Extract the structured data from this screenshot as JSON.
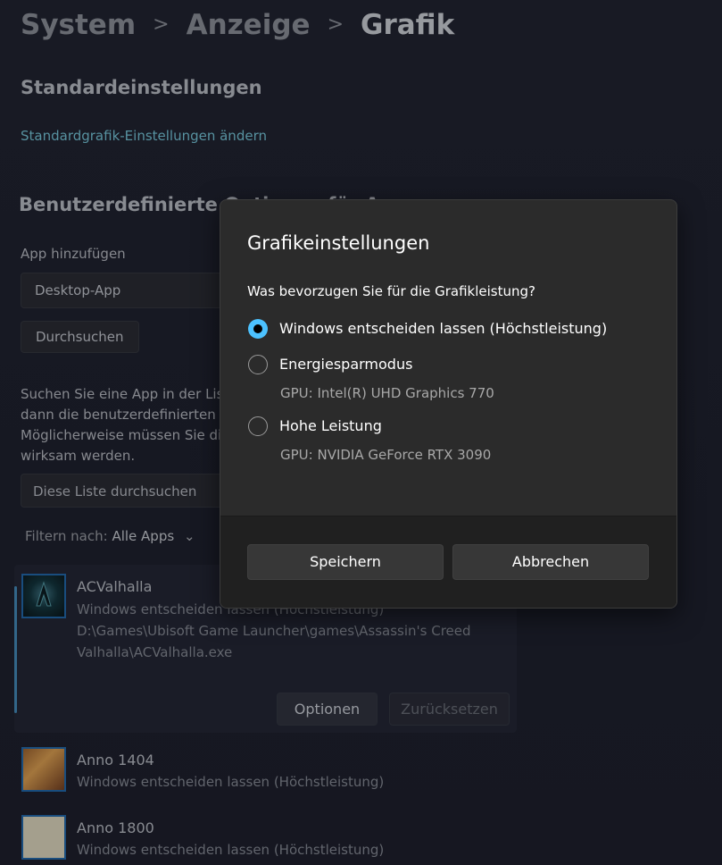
{
  "breadcrumb": {
    "items": [
      "System",
      "Anzeige",
      "Grafik"
    ]
  },
  "section_default": {
    "title": "Standardeinstellungen",
    "link": "Standardgrafik-Einstellungen ändern"
  },
  "section_custom": {
    "title": "Benutzerdefinierte Optionen für Apps",
    "add_app_label": "App hinzufügen",
    "app_type_value": "Desktop-App",
    "browse_button": "Durchsuchen",
    "description_lines": [
      "Suchen Sie eine App in der Liste, wählen Sie sie aus und wählen Sie",
      "dann die benutzerdefinierten Grafikeinstellungen dafür aus.",
      "Möglicherweise müssen Sie die App neu starten, damit Ihre Änderungen",
      "wirksam werden."
    ],
    "search_placeholder": "Diese Liste durchsuchen",
    "filter_label": "Filtern nach:",
    "filter_value": "Alle Apps"
  },
  "apps": [
    {
      "name": "ACValhalla",
      "setting": "Windows entscheiden lassen (Höchstleistung)",
      "path_lines": [
        "D:\\Games\\Ubisoft Game Launcher\\games\\Assassin's Creed",
        "Valhalla\\ACValhalla.exe"
      ],
      "options_button": "Optionen",
      "reset_button": "Zurücksetzen"
    },
    {
      "name": "Anno 1404",
      "setting": "Windows entscheiden lassen (Höchstleistung)"
    },
    {
      "name": "Anno 1800",
      "setting": "Windows entscheiden lassen (Höchstleistung)"
    }
  ],
  "dialog": {
    "title": "Grafikeinstellungen",
    "question": "Was bevorzugen Sie für die Grafikleistung?",
    "options": [
      {
        "label": "Windows entscheiden lassen (Höchstleistung)",
        "sub": "",
        "selected": true
      },
      {
        "label": "Energiesparmodus",
        "sub": "GPU: Intel(R) UHD Graphics 770",
        "selected": false
      },
      {
        "label": "Hohe Leistung",
        "sub": "GPU: NVIDIA GeForce RTX 3090",
        "selected": false
      }
    ],
    "save_button": "Speichern",
    "cancel_button": "Abbrechen"
  },
  "colors": {
    "accent": "#4cc2ff",
    "link": "#6bb2c4",
    "dialog_bg": "#2b2b2b"
  }
}
